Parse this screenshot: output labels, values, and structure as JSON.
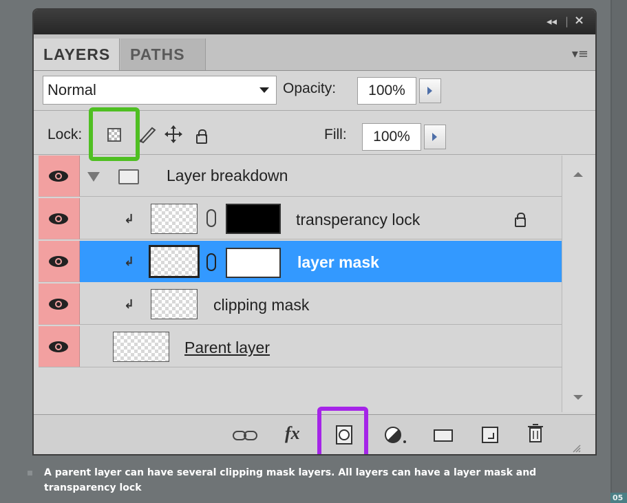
{
  "window": {
    "collapse_glyph": "◂◂",
    "close_glyph": "×"
  },
  "tabs": [
    {
      "label": "LAYERS",
      "active": true
    },
    {
      "label": "PATHS",
      "active": false
    }
  ],
  "panel_menu_glyph": "▾≡",
  "blend_mode": {
    "value": "Normal"
  },
  "opacity": {
    "label": "Opacity:",
    "value": "100%"
  },
  "lock": {
    "label": "Lock:"
  },
  "fill": {
    "label": "Fill:",
    "value": "100%"
  },
  "layers": [
    {
      "name": "Layer breakdown",
      "type": "group",
      "visible": true
    },
    {
      "name": "transperancy lock",
      "type": "clipped_with_mask",
      "mask_color": "#000000",
      "locked": true,
      "visible": true
    },
    {
      "name": "layer mask",
      "type": "clipped_with_mask",
      "mask_color": "#ffffff",
      "selected": true,
      "visible": true
    },
    {
      "name": "clipping mask",
      "type": "clipped",
      "visible": true
    },
    {
      "name": "Parent layer",
      "type": "base",
      "visible": true
    }
  ],
  "bottom_icons": [
    "link-layers-icon",
    "fx-icon",
    "add-layer-mask-icon",
    "adjustment-layer-icon",
    "new-group-icon",
    "new-layer-icon",
    "trash-icon"
  ],
  "fx_label": "fx",
  "colors": {
    "selection": "#3399ff",
    "eye_column": "#f2a0a0",
    "green_highlight": "#4fbf22",
    "purple_highlight": "#a524e8"
  },
  "caption": "A parent layer can have several clipping mask layers. All layers can have a layer mask and transparency lock",
  "corner_badge": "05"
}
